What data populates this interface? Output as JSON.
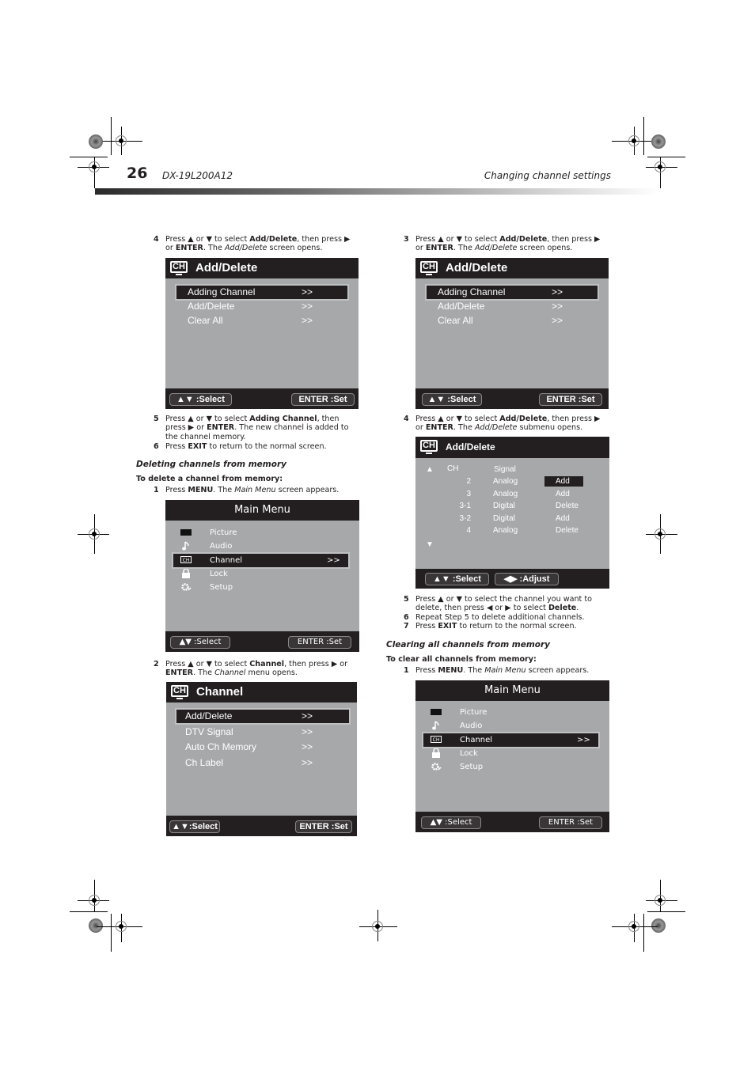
{
  "header": {
    "page_number": "26",
    "model": "DX-19L200A12",
    "section": "Changing channel settings"
  },
  "left": {
    "step4": {
      "num": "4",
      "pre": "Press ▲ or ▼ to select ",
      "b1": "Add/Delete",
      "mid": ", then press ▶ or ",
      "b2": "ENTER",
      "post1": ". The ",
      "i1": "Add/Delete",
      "post2": " screen opens."
    },
    "screen1": {
      "title": "Add/Delete",
      "items": [
        {
          "label": "Adding Channel",
          "arrow": ">>"
        },
        {
          "label": "Add/Delete",
          "arrow": ">>"
        },
        {
          "label": "Clear All",
          "arrow": ">>"
        }
      ],
      "btn_select": "▲▼ :Select",
      "btn_set": "ENTER :Set"
    },
    "step5": {
      "num": "5",
      "pre": "Press ▲ or ▼ to select ",
      "b1": "Adding Channel",
      "mid": ", then press ▶ or ",
      "b2": "ENTER",
      "post": ". The new channel is added to the channel memory."
    },
    "step6": {
      "num": "6",
      "pre": "Press ",
      "b1": "EXIT",
      "post": " to return to the normal screen."
    },
    "heading_deleting": "Deleting channels from memory",
    "subheading_delete": "To delete a channel from memory:",
    "step1": {
      "num": "1",
      "pre": "Press ",
      "b1": "MENU",
      "mid": ". The ",
      "i1": "Main Menu",
      "post": " screen appears."
    },
    "screen2": {
      "title": "Main Menu",
      "items": [
        {
          "label": "Picture",
          "icon": "picture-icon"
        },
        {
          "label": "Audio",
          "icon": "music-note-icon"
        },
        {
          "label": "Channel",
          "icon": "channel-icon",
          "arrow": ">>"
        },
        {
          "label": "Lock",
          "icon": "lock-icon"
        },
        {
          "label": "Setup",
          "icon": "gear-icon"
        }
      ],
      "btn_select": "▲▼ :Select",
      "btn_set": "ENTER :Set"
    },
    "step2": {
      "num": "2",
      "pre": "Press ▲ or ▼ to select ",
      "b1": "Channel",
      "mid": ", then press ▶ or ",
      "b2": "ENTER",
      "post1": ". The ",
      "i1": "Channel",
      "post2": " menu opens."
    },
    "screen3": {
      "title": "Channel",
      "items": [
        {
          "label": "Add/Delete",
          "arrow": ">>"
        },
        {
          "label": "DTV Signal",
          "arrow": ">>"
        },
        {
          "label": "Auto Ch Memory",
          "arrow": ">>"
        },
        {
          "label": "Ch Label",
          "arrow": ">>"
        }
      ],
      "btn_select": "▲▼:Select",
      "btn_set": "ENTER :Set"
    }
  },
  "right": {
    "step3": {
      "num": "3",
      "pre": "Press ▲ or ▼ to select ",
      "b1": "Add/Delete",
      "mid": ", then press ▶ or ",
      "b2": "ENTER",
      "post1": ". The ",
      "i1": "Add/Delete",
      "post2": " screen opens."
    },
    "screen4": {
      "title": "Add/Delete",
      "items": [
        {
          "label": "Adding Channel",
          "arrow": ">>"
        },
        {
          "label": "Add/Delete",
          "arrow": ">>"
        },
        {
          "label": "Clear All",
          "arrow": ">>"
        }
      ],
      "btn_select": "▲▼ :Select",
      "btn_set": "ENTER :Set"
    },
    "step4": {
      "num": "4",
      "pre": "Press ▲ or ▼ to select ",
      "b1": "Add/Delete",
      "mid": ", then press ▶ or ",
      "b2": "ENTER",
      "post1": ". The ",
      "i1": "Add/Delete",
      "post2": " submenu opens."
    },
    "screen5": {
      "title": "Add/Delete",
      "col_ch": "CH",
      "col_signal": "Signal",
      "rows": [
        {
          "ch": "2",
          "signal": "Analog",
          "status": "Add"
        },
        {
          "ch": "3",
          "signal": "Analog",
          "status": "Add"
        },
        {
          "ch": "3-1",
          "signal": "Digital",
          "status": "Delete"
        },
        {
          "ch": "3-2",
          "signal": "Digital",
          "status": "Add"
        },
        {
          "ch": "4",
          "signal": "Analog",
          "status": "Delete"
        }
      ],
      "btn_select": "▲▼ :Select",
      "btn_adjust": "◀▶ :Adjust"
    },
    "step5": {
      "num": "5",
      "pre": "Press ▲ or ▼ to select the channel you want to delete, then press ◀ or ▶ to select ",
      "b1": "Delete",
      "post": "."
    },
    "step6": {
      "num": "6",
      "text": "Repeat Step 5 to delete additional channels."
    },
    "step7": {
      "num": "7",
      "pre": "Press ",
      "b1": "EXIT",
      "post": " to return to the normal screen."
    },
    "heading_clearing": "Clearing all channels from memory",
    "subheading_clear": "To clear all channels from memory:",
    "step1": {
      "num": "1",
      "pre": "Press ",
      "b1": "MENU",
      "mid": ". The ",
      "i1": "Main Menu",
      "post": " screen appears."
    },
    "screen6": {
      "title": "Main Menu",
      "items": [
        {
          "label": "Picture"
        },
        {
          "label": "Audio"
        },
        {
          "label": "Channel",
          "arrow": ">>"
        },
        {
          "label": "Lock"
        },
        {
          "label": "Setup"
        }
      ],
      "btn_select": "▲▼ :Select",
      "btn_set": "ENTER :Set"
    }
  }
}
